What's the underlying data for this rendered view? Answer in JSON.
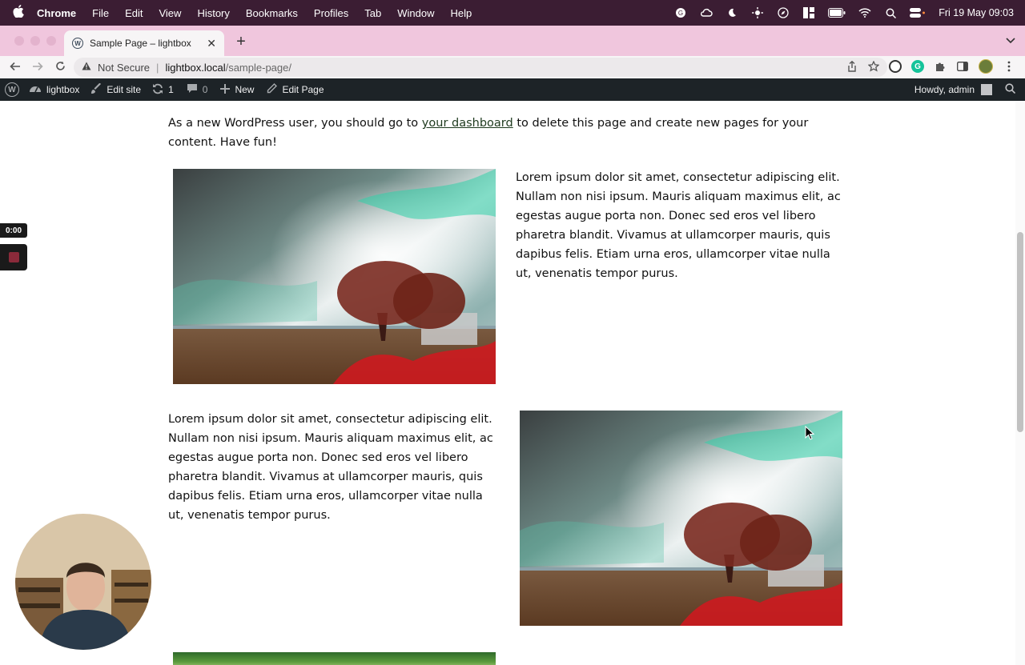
{
  "menubar": {
    "app": "Chrome",
    "items": [
      "File",
      "Edit",
      "View",
      "History",
      "Bookmarks",
      "Profiles",
      "Tab",
      "Window",
      "Help"
    ],
    "clock": "Fri 19 May  09:03"
  },
  "browser": {
    "tab_title": "Sample Page – lightbox",
    "tab_close": "✕",
    "new_tab": "+",
    "security_label": "Not Secure",
    "url_host": "lightbox.local",
    "url_path": "/sample-page/"
  },
  "adminbar": {
    "site_name": "lightbox",
    "edit_site": "Edit site",
    "updates_count": "1",
    "comments_count": "0",
    "new_label": "New",
    "edit_page": "Edit Page",
    "howdy": "Howdy, admin"
  },
  "page": {
    "intro_before": "As a new WordPress user, you should go to ",
    "intro_link": "your dashboard",
    "intro_after": " to delete this page and create new pages for your content. Have fun!",
    "paragraph_1": "Lorem ipsum dolor sit amet, consectetur adipiscing elit. Nullam non nisi ipsum. Mauris aliquam maximus elit, ac egestas augue porta non. Donec sed eros vel libero pharetra blandit. Vivamus at ullamcorper mauris, quis dapibus felis. Etiam urna eros, ullamcorper vitae nulla ut, venenatis tempor purus.",
    "paragraph_2": "Lorem ipsum dolor sit amet, consectetur adipiscing elit. Nullam non nisi ipsum. Mauris aliquam maximus elit, ac egestas augue porta non. Donec sed eros vel libero pharetra blandit. Vivamus at ullamcorper mauris, quis dapibus felis. Etiam urna eros, ullamcorper vitae nulla ut, venenatis tempor purus."
  },
  "recorder": {
    "elapsed": "0:00"
  },
  "colors": {
    "macos_menubar": "#3b1d33",
    "chrome_frame": "#f0c6dd",
    "wp_adminbar": "#1d2327",
    "link": "#1e3a1e"
  }
}
